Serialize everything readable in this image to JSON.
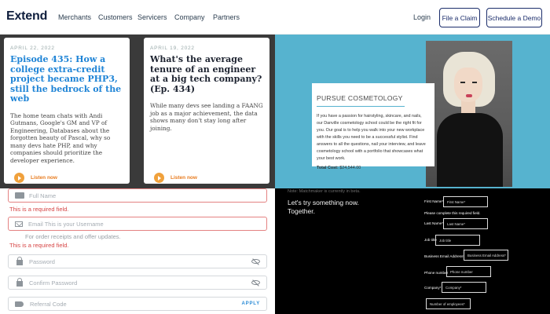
{
  "header": {
    "logo": "Extend",
    "nav": [
      "Merchants",
      "Customers",
      "Servicers",
      "Company",
      "Partners"
    ],
    "login": "Login",
    "file_claim": "File a Claim",
    "schedule_demo": "Schedule a Demo"
  },
  "podcast": {
    "cards": [
      {
        "date": "APRIL 22, 2022",
        "title": "Episode 435: How a college extra-credit project became PHP3, still the bedrock of the web",
        "description": "The home team chats with Andi Gutmans, Google's GM and VP of Engineering, Databases about the forgotten beauty of Pascal, why so many devs hate PHP, and why companies should prioritize the developer experience.",
        "listen": "Listen now"
      },
      {
        "date": "APRIL 19, 2022",
        "title": "What's the average tenure of an engineer at a big tech company? (Ep. 434)",
        "description": "While many devs see landing a FAANG job as a major achievement, the data shows many don't stay long after joining.",
        "listen": "Listen now"
      }
    ]
  },
  "cosmetology": {
    "title": "PURSUE COSMETOLOGY",
    "body": "If you have a passion for hairstyling, skincare, and nails, our Danville cosmetology school could be the right fit for you. Our goal is to help you walk into your new workplace with the skills you need to be a successful stylist. Find answers to all the questions, nail your interview, and leave cosmetology school with a portfolio that showcases what your best work.",
    "cost_label": "Total Cost:",
    "cost_value": "$24,544.00"
  },
  "signup": {
    "full_name": "Full Name",
    "full_name_error": "This is a required field.",
    "email_placeholder": "Email   This is your Username",
    "email_hint": "For order receipts and offer updates.",
    "email_error": "This is a required field.",
    "password": "Password",
    "confirm_password": "Confirm Password",
    "referral_code": "Referral Code",
    "apply": "APPLY"
  },
  "dark_form": {
    "faint_top": "Note: Matchmaker is currently in beta.",
    "headline_1": "Let's try something now.",
    "headline_2": "Together.",
    "first_name_label": "First Name*",
    "first_name_placeholder": "First Name*",
    "error": "Please complete this required field.",
    "last_name_label": "Last Name*",
    "last_name_placeholder": "Last Name*",
    "job_title_label": "Job title",
    "job_title_placeholder": "Job title",
    "email_label": "Business Email Address*",
    "email_placeholder": "Business Email Address*",
    "phone_label": "Phone number",
    "phone_placeholder": "Phone number",
    "company_label": "Company*",
    "company_placeholder": "Company*",
    "employees_placeholder": "Number of employees*"
  }
}
